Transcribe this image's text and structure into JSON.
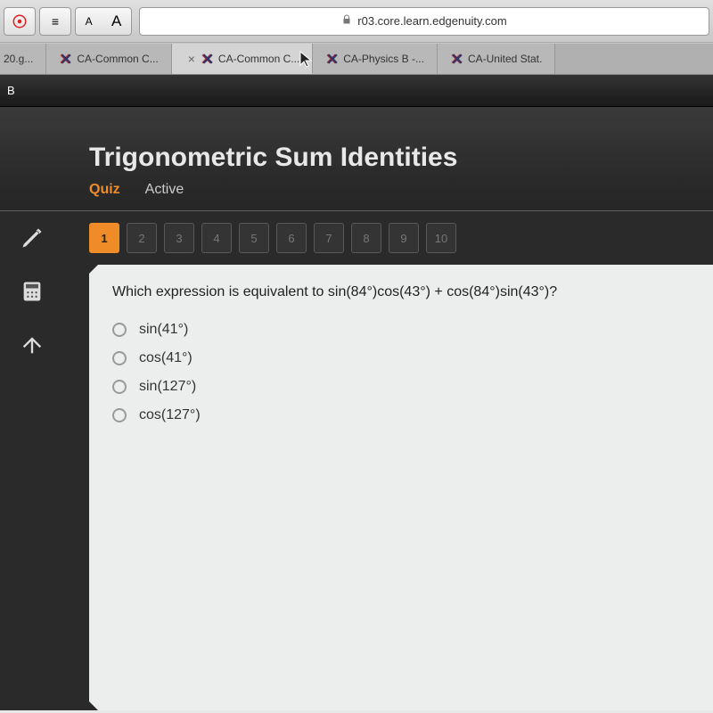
{
  "browser": {
    "url": "r03.core.learn.edgenuity.com",
    "text_size_a": "A",
    "text_size_a2": "A",
    "reader_icon": "≡"
  },
  "tabs": [
    {
      "label": "20.g..."
    },
    {
      "label": "CA-Common C..."
    },
    {
      "label": "CA-Common C..."
    },
    {
      "label": "CA-Physics B -..."
    },
    {
      "label": "CA-United Stat."
    }
  ],
  "header_letter": "B",
  "lesson": {
    "title": "Trigonometric Sum Identities",
    "quiz": "Quiz",
    "status": "Active"
  },
  "question_numbers": [
    "1",
    "2",
    "3",
    "4",
    "5",
    "6",
    "7",
    "8",
    "9",
    "10"
  ],
  "active_question": "1",
  "question": {
    "text": "Which expression is equivalent to sin(84°)cos(43°) + cos(84°)sin(43°)?",
    "options": [
      "sin(41°)",
      "cos(41°)",
      "sin(127°)",
      "cos(127°)"
    ]
  }
}
